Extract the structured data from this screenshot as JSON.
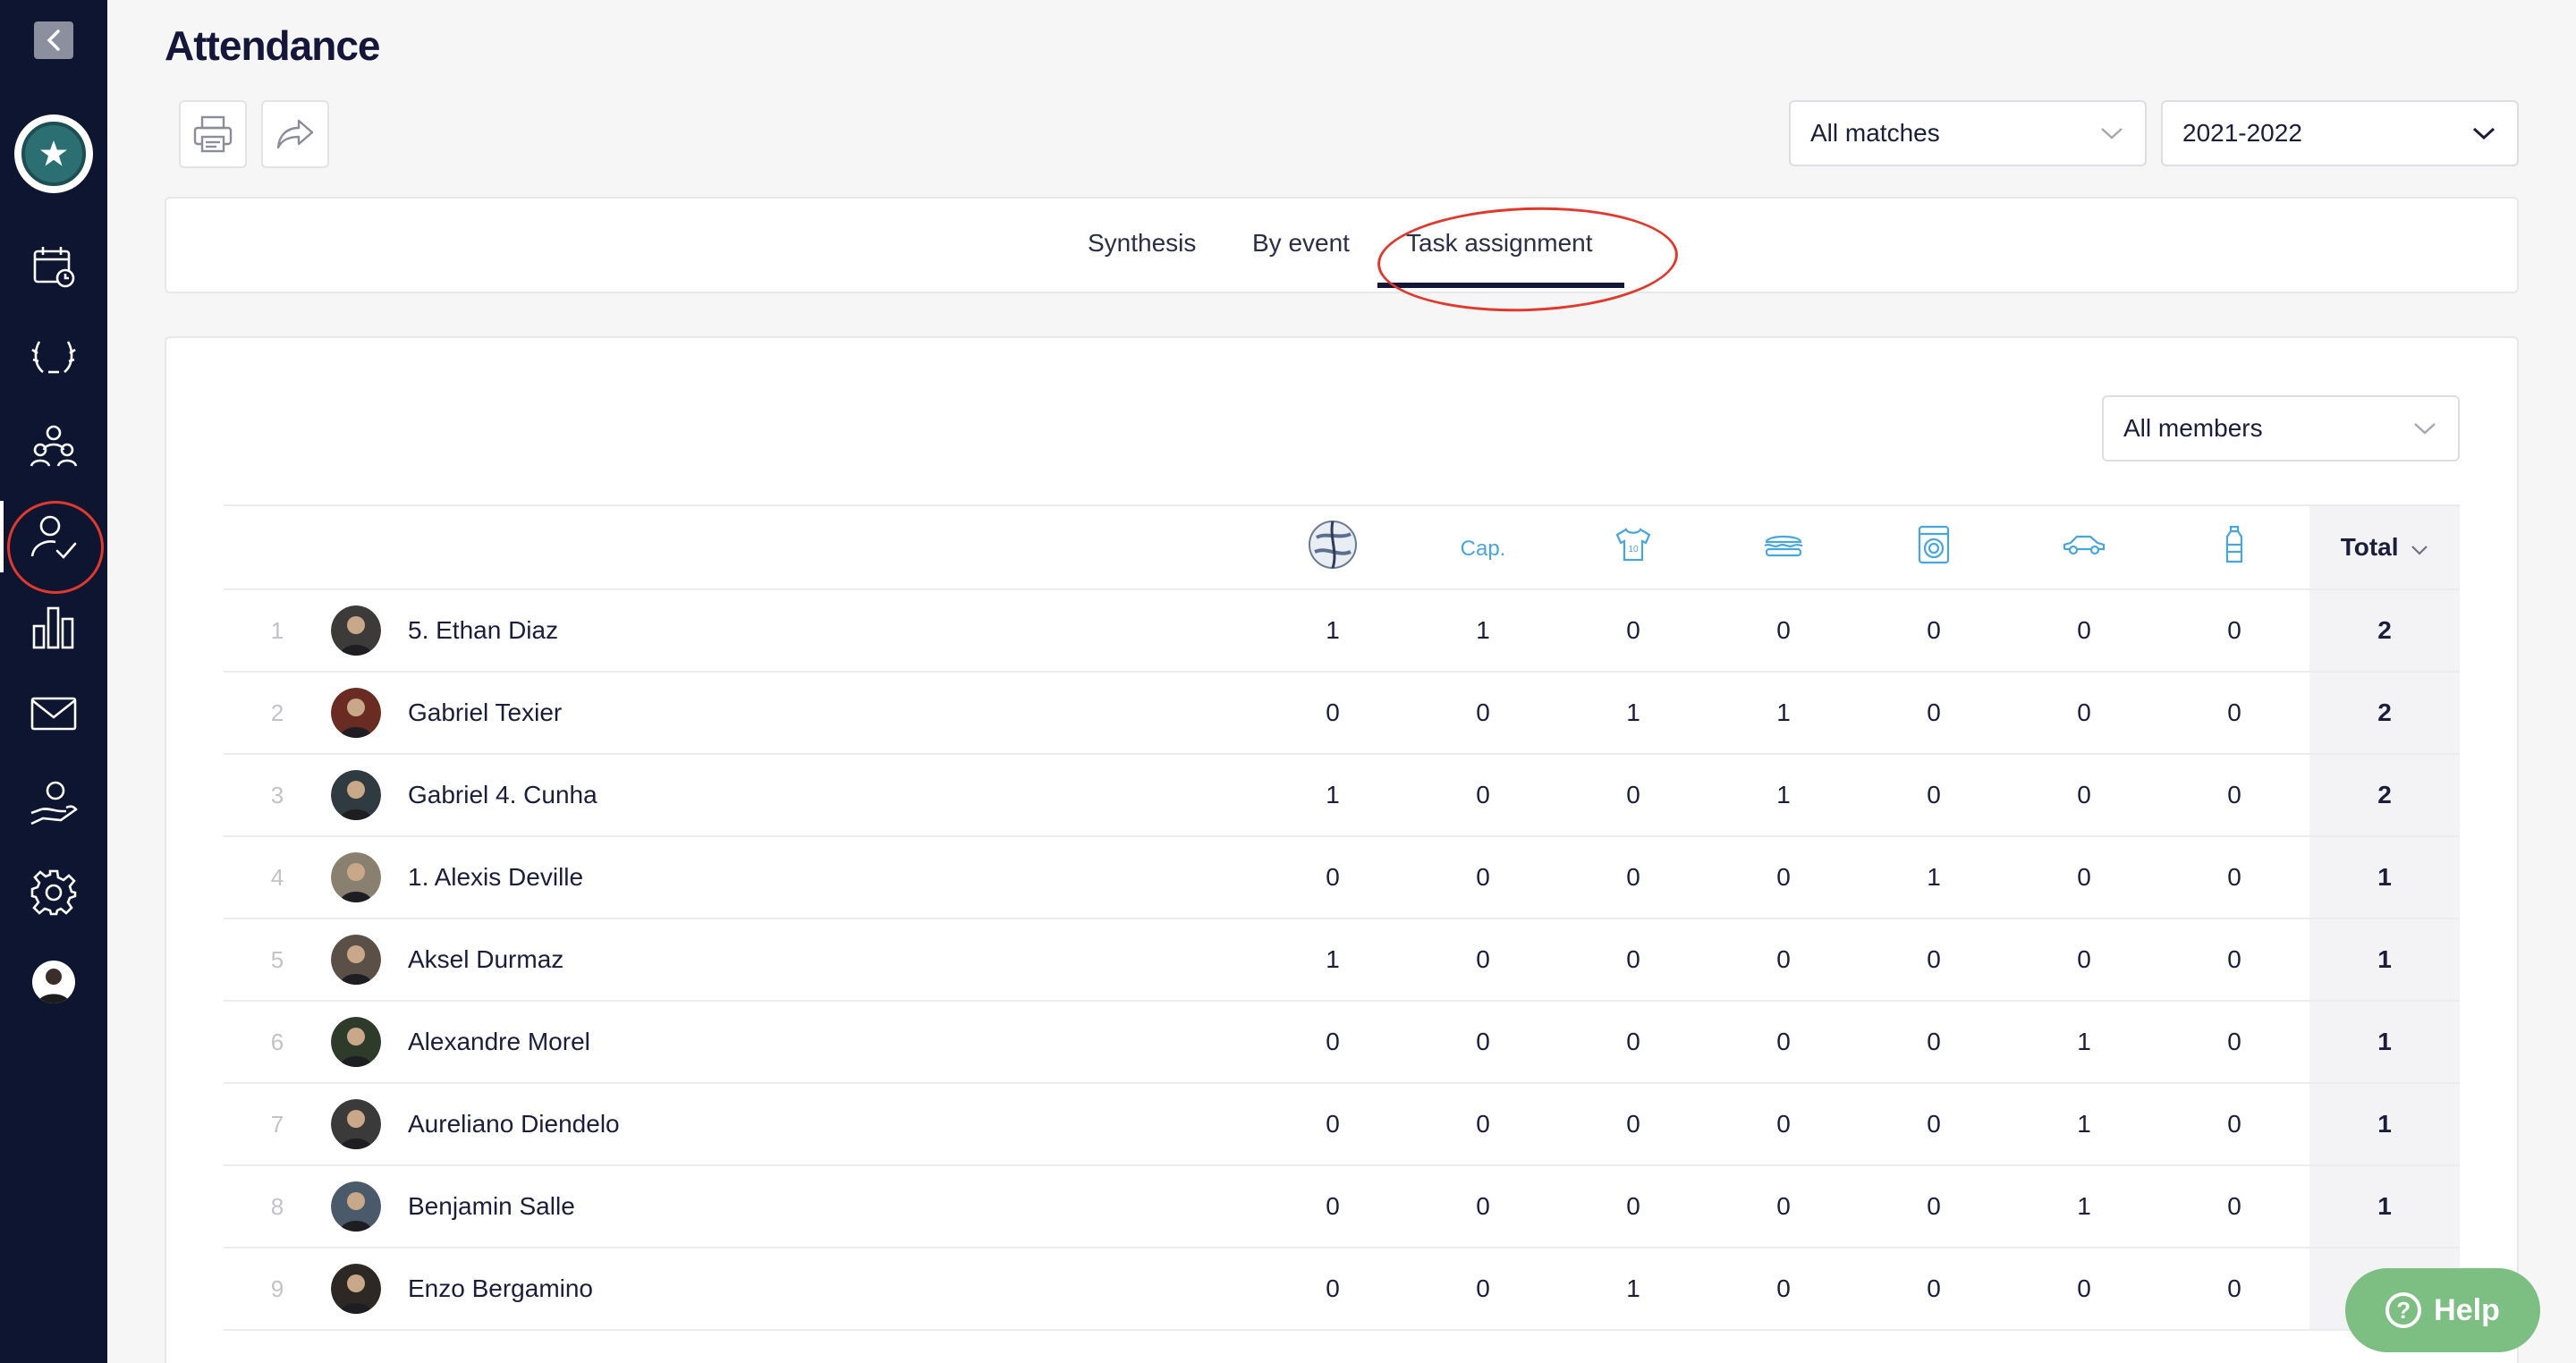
{
  "page": {
    "title": "Attendance"
  },
  "filters": {
    "match_filter": "All matches",
    "season": "2021-2022",
    "members_filter": "All members"
  },
  "tabs": [
    {
      "label": "Synthesis"
    },
    {
      "label": "By event"
    },
    {
      "label": "Task assignment",
      "active": true
    }
  ],
  "table": {
    "columns": [
      {
        "icon": "ball-icon"
      },
      {
        "label": "Cap."
      },
      {
        "icon": "jersey-icon"
      },
      {
        "icon": "sandwich-icon"
      },
      {
        "icon": "washing-machine-icon"
      },
      {
        "icon": "car-icon"
      },
      {
        "icon": "water-bottle-icon"
      }
    ],
    "total_label": "Total",
    "rows": [
      {
        "rank": "1",
        "name": "5. Ethan Diaz",
        "values": [
          "1",
          "1",
          "0",
          "0",
          "0",
          "0",
          "0"
        ],
        "total": "2"
      },
      {
        "rank": "2",
        "name": "Gabriel Texier",
        "values": [
          "0",
          "0",
          "1",
          "1",
          "0",
          "0",
          "0"
        ],
        "total": "2"
      },
      {
        "rank": "3",
        "name": "Gabriel 4. Cunha",
        "values": [
          "1",
          "0",
          "0",
          "1",
          "0",
          "0",
          "0"
        ],
        "total": "2"
      },
      {
        "rank": "4",
        "name": "1. Alexis Deville",
        "values": [
          "0",
          "0",
          "0",
          "0",
          "1",
          "0",
          "0"
        ],
        "total": "1"
      },
      {
        "rank": "5",
        "name": "Aksel Durmaz",
        "values": [
          "1",
          "0",
          "0",
          "0",
          "0",
          "0",
          "0"
        ],
        "total": "1"
      },
      {
        "rank": "6",
        "name": "Alexandre Morel",
        "values": [
          "0",
          "0",
          "0",
          "0",
          "0",
          "1",
          "0"
        ],
        "total": "1"
      },
      {
        "rank": "7",
        "name": "Aureliano Diendelo",
        "values": [
          "0",
          "0",
          "0",
          "0",
          "0",
          "1",
          "0"
        ],
        "total": "1"
      },
      {
        "rank": "8",
        "name": "Benjamin Salle",
        "values": [
          "0",
          "0",
          "0",
          "0",
          "0",
          "1",
          "0"
        ],
        "total": "1"
      },
      {
        "rank": "9",
        "name": "Enzo Bergamino",
        "values": [
          "0",
          "0",
          "1",
          "0",
          "0",
          "0",
          "0"
        ],
        "total": ""
      }
    ]
  },
  "help": {
    "label": "Help"
  },
  "colors": {
    "sidebar": "#0e1530",
    "accent_blue": "#49a6dd",
    "annotation_red": "#e0392d",
    "help_green": "#7dbf82"
  }
}
